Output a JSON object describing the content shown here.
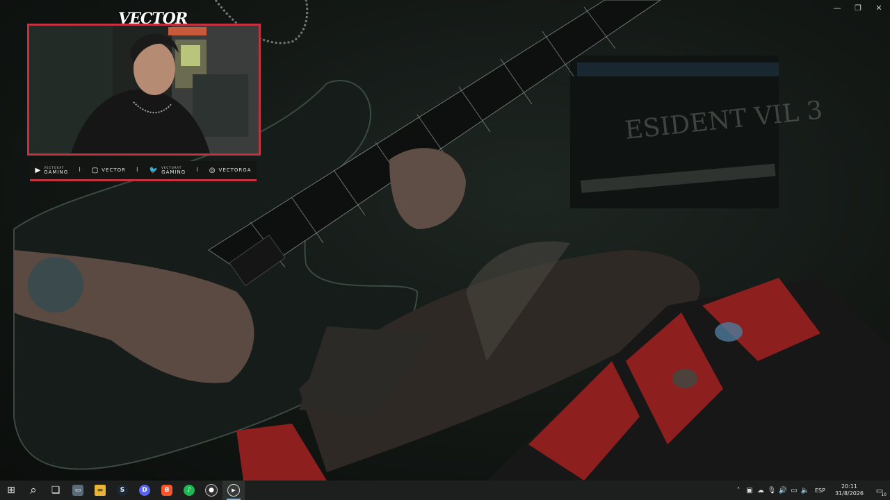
{
  "overlay": {
    "logo_text": "VECTOR",
    "socials": [
      {
        "icon": "youtube-icon",
        "line1": "VECTORAT",
        "line2": "GAMING"
      },
      {
        "icon": "twitch-icon",
        "line1": "",
        "line2": "VECTOR"
      },
      {
        "icon": "twitter-icon",
        "line1": "VECTORAT",
        "line2": "GAMING"
      },
      {
        "icon": "instagram-icon",
        "line1": "",
        "line2": "VECTORGA"
      }
    ],
    "separator": "I",
    "accent_color": "#c2323f"
  },
  "window_controls": {
    "minimize": "—",
    "restore": "❐",
    "close": "✕"
  },
  "background_text": "ESIDENT VIL 3",
  "taskbar": {
    "start_glyph": "⊞",
    "search_glyph": "⌕",
    "task_view_glyph": "❏",
    "apps": [
      {
        "name": "tablet-app",
        "glyph": "▭",
        "color": "#5a6b7a"
      },
      {
        "name": "file-explorer",
        "glyph": "▬",
        "color": "#e8b339"
      },
      {
        "name": "steam",
        "glyph": "S",
        "color": "#1b2838"
      },
      {
        "name": "discord",
        "glyph": "D",
        "color": "#5865f2"
      },
      {
        "name": "brave",
        "glyph": "B",
        "color": "#fb542b"
      },
      {
        "name": "spotify",
        "glyph": "♪",
        "color": "#1db954"
      },
      {
        "name": "obs",
        "glyph": "●",
        "color": "#302e31"
      },
      {
        "name": "media-player",
        "glyph": "▶",
        "color": "#3a3a3a"
      }
    ],
    "tray": {
      "chevron": "˄",
      "icons": [
        "▣",
        "☁",
        "🎙",
        "🔊",
        "▭",
        "🔈"
      ],
      "language": "ESP",
      "time": "20:11",
      "date": "31/8/2026",
      "notification_count": "10"
    }
  }
}
